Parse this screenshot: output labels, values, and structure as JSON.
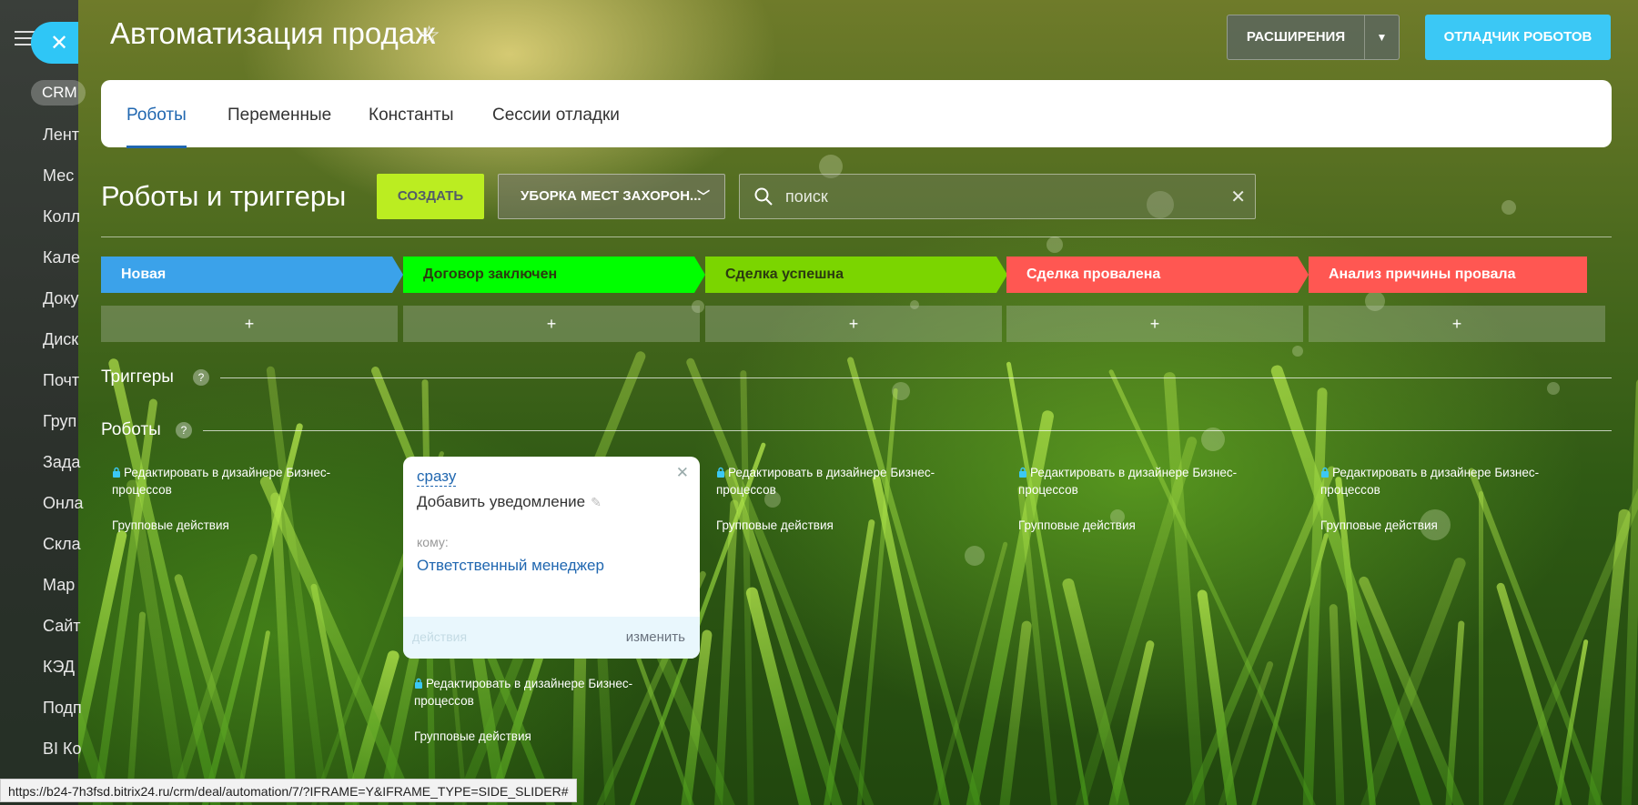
{
  "sidebar": {
    "crm_chip": "CRM",
    "items": [
      "Лент",
      "Мес",
      "Колл",
      "Кале",
      "Доку",
      "Диск",
      "Почт",
      "Груп",
      "Зада",
      "Онла",
      "Скла",
      "Мар",
      "Сайт",
      "КЭД",
      "Подп",
      "BI Ко"
    ]
  },
  "header": {
    "title": "Автоматизация продаж",
    "extensions_label": "РАСШИРЕНИЯ",
    "debugger_label": "ОТЛАДЧИК РОБОТОВ"
  },
  "tabs": [
    {
      "label": "Роботы",
      "active": true
    },
    {
      "label": "Переменные",
      "active": false
    },
    {
      "label": "Константы",
      "active": false
    },
    {
      "label": "Сессии отладки",
      "active": false
    }
  ],
  "toolbar": {
    "section_title": "Роботы и триггеры",
    "create_label": "СОЗДАТЬ",
    "filter_label": "УБОРКА МЕСТ ЗАХОРОН...",
    "search_placeholder": "поиск"
  },
  "stages": [
    {
      "name": "Новая",
      "color": "#3ba2ea"
    },
    {
      "name": "Договор заключен",
      "color": "#00ff00"
    },
    {
      "name": "Сделка успешна",
      "color": "#7bd500"
    },
    {
      "name": "Сделка провалена",
      "color": "#ff5752"
    },
    {
      "name": "Анализ причины провала",
      "color": "#ff5752"
    }
  ],
  "add_symbol": "+",
  "triggers_title": "Триггеры",
  "robots_title": "Роботы",
  "help_symbol": "?",
  "column_links": {
    "edit_in_designer": "Редактировать в дизайнере Бизнес-процессов",
    "group_actions": "Групповые действия"
  },
  "robot_card": {
    "when": "сразу",
    "title": "Добавить уведомление",
    "to_label": "кому:",
    "to_value": "Ответственный менеджер",
    "actions_label": "действия",
    "edit_label": "изменить"
  },
  "statusbar": {
    "url": "https://b24-7h3fsd.bitrix24.ru/crm/deal/automation/7/?IFRAME=Y&IFRAME_TYPE=SIDE_SLIDER#"
  }
}
